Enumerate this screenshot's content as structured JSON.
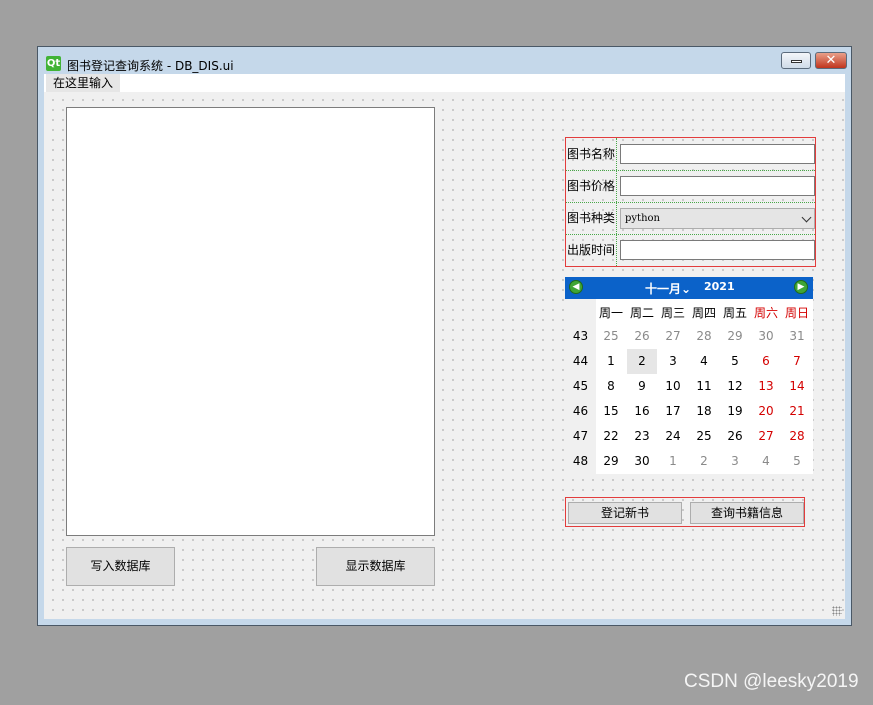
{
  "window": {
    "title": "图书登记查询系统 - DB_DIS.ui",
    "logo_text": "Qt"
  },
  "menubar": {
    "placeholder_item": "在这里输入"
  },
  "left_panel": {
    "write_button": "写入数据库",
    "show_button": "显示数据库"
  },
  "form": {
    "name_label": "图书名称",
    "price_label": "图书价格",
    "category_label": "图书种类",
    "category_value": "python",
    "date_label": "出版时间",
    "name_value": "",
    "price_value": "",
    "date_value": ""
  },
  "calendar": {
    "month": "十一月",
    "year": "2021",
    "selected_day": "2",
    "weekday_headers": [
      "周一",
      "周二",
      "周三",
      "周四",
      "周五",
      "周六",
      "周日"
    ],
    "rows": [
      {
        "week": "43",
        "days": [
          "25",
          "26",
          "27",
          "28",
          "29",
          "30",
          "31"
        ]
      },
      {
        "week": "44",
        "days": [
          "1",
          "2",
          "3",
          "4",
          "5",
          "6",
          "7"
        ]
      },
      {
        "week": "45",
        "days": [
          "8",
          "9",
          "10",
          "11",
          "12",
          "13",
          "14"
        ]
      },
      {
        "week": "46",
        "days": [
          "15",
          "16",
          "17",
          "18",
          "19",
          "20",
          "21"
        ]
      },
      {
        "week": "47",
        "days": [
          "22",
          "23",
          "24",
          "25",
          "26",
          "27",
          "28"
        ]
      },
      {
        "week": "48",
        "days": [
          "29",
          "30",
          "1",
          "2",
          "3",
          "4",
          "5"
        ]
      }
    ],
    "weekend_color": "#d40000",
    "other_month_color": "#8a8a8a"
  },
  "actions": {
    "register_button": "登记新书",
    "query_button": "查询书籍信息"
  },
  "watermark": "CSDN @leesky2019"
}
